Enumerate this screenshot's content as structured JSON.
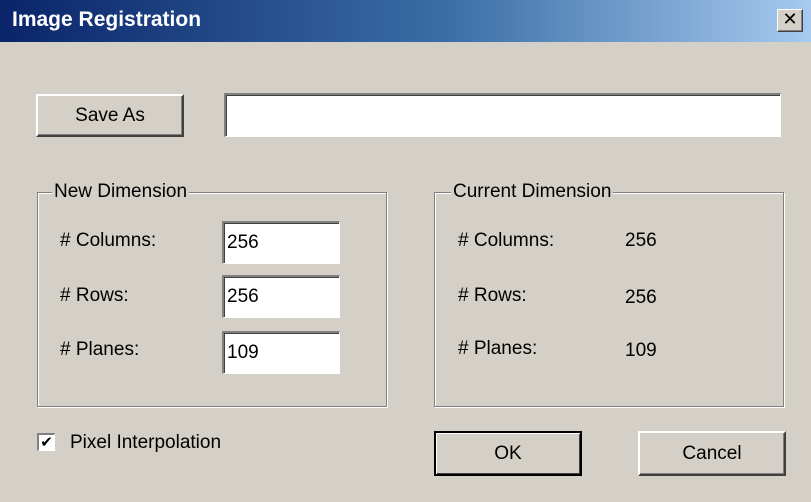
{
  "window": {
    "title": "Image Registration",
    "close_glyph": "✕"
  },
  "save": {
    "button_label": "Save As",
    "path_value": ""
  },
  "new_dimension": {
    "legend": "New Dimension",
    "columns_label": "# Columns:",
    "columns_value": "256",
    "rows_label": "# Rows:",
    "rows_value": "256",
    "planes_label": "# Planes:",
    "planes_value": "109"
  },
  "current_dimension": {
    "legend": "Current Dimension",
    "columns_label": "# Columns:",
    "columns_value": "256",
    "rows_label": "# Rows:",
    "rows_value": "256",
    "planes_label": "# Planes:",
    "planes_value": "109"
  },
  "options": {
    "pixel_interpolation_label": "Pixel Interpolation",
    "pixel_interpolation_checked": true,
    "check_glyph": "✔"
  },
  "buttons": {
    "ok_label": "OK",
    "cancel_label": "Cancel"
  },
  "icons": {
    "close": "close-icon",
    "checkmark": "checkmark-icon"
  },
  "colors": {
    "titlebar_start": "#0a246a",
    "titlebar_end": "#a6caf0",
    "face": "#d4d0c8"
  }
}
